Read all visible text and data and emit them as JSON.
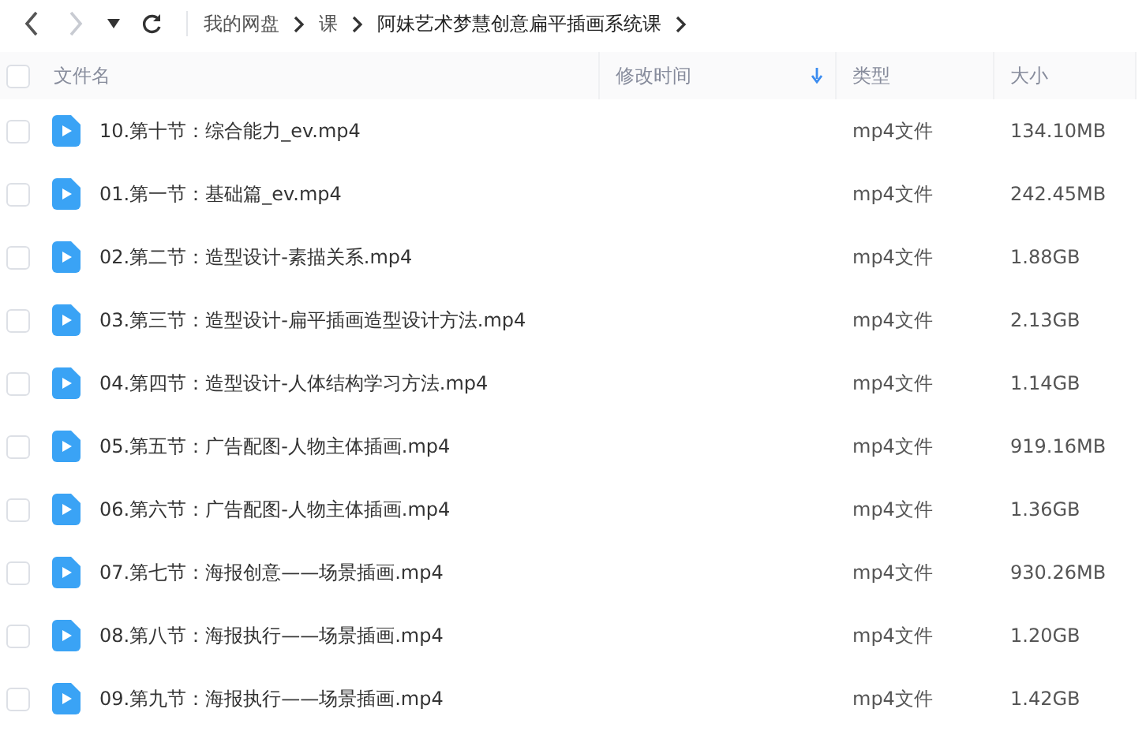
{
  "toolbar": {
    "back": {
      "disabled": false
    },
    "forward": {
      "disabled": true
    },
    "breadcrumbs": [
      {
        "label": "我的网盘",
        "current": false
      },
      {
        "label": "课",
        "current": false
      },
      {
        "label": "阿妹艺术梦慧创意扁平插画系统课",
        "current": true
      }
    ]
  },
  "table": {
    "select_all": {
      "checked": false
    },
    "columns": [
      {
        "kind": "name",
        "label": "文件名",
        "sorted": false
      },
      {
        "kind": "modified",
        "label": "修改时间",
        "sorted": true
      },
      {
        "kind": "type",
        "label": "类型",
        "sorted": false
      },
      {
        "kind": "size",
        "label": "大小",
        "sorted": false
      }
    ],
    "rows": [
      {
        "checked": false,
        "name": "10.第十节：综合能力_ev.mp4",
        "type": "mp4文件",
        "size": "134.10MB"
      },
      {
        "checked": false,
        "name": "01.第一节：基础篇_ev.mp4",
        "type": "mp4文件",
        "size": "242.45MB"
      },
      {
        "checked": false,
        "name": "02.第二节：造型设计-素描关系.mp4",
        "type": "mp4文件",
        "size": "1.88GB"
      },
      {
        "checked": false,
        "name": "03.第三节：造型设计-扁平插画造型设计方法.mp4",
        "type": "mp4文件",
        "size": "2.13GB"
      },
      {
        "checked": false,
        "name": "04.第四节：造型设计-人体结构学习方法.mp4",
        "type": "mp4文件",
        "size": "1.14GB"
      },
      {
        "checked": false,
        "name": "05.第五节：广告配图-人物主体插画.mp4",
        "type": "mp4文件",
        "size": "919.16MB"
      },
      {
        "checked": false,
        "name": "06.第六节：广告配图-人物主体插画.mp4",
        "type": "mp4文件",
        "size": "1.36GB"
      },
      {
        "checked": false,
        "name": "07.第七节：海报创意——场景插画.mp4",
        "type": "mp4文件",
        "size": "930.26MB"
      },
      {
        "checked": false,
        "name": "08.第八节：海报执行——场景插画.mp4",
        "type": "mp4文件",
        "size": "1.20GB"
      },
      {
        "checked": false,
        "name": "09.第九节：海报执行——场景插画.mp4",
        "type": "mp4文件",
        "size": "1.42GB"
      }
    ]
  }
}
